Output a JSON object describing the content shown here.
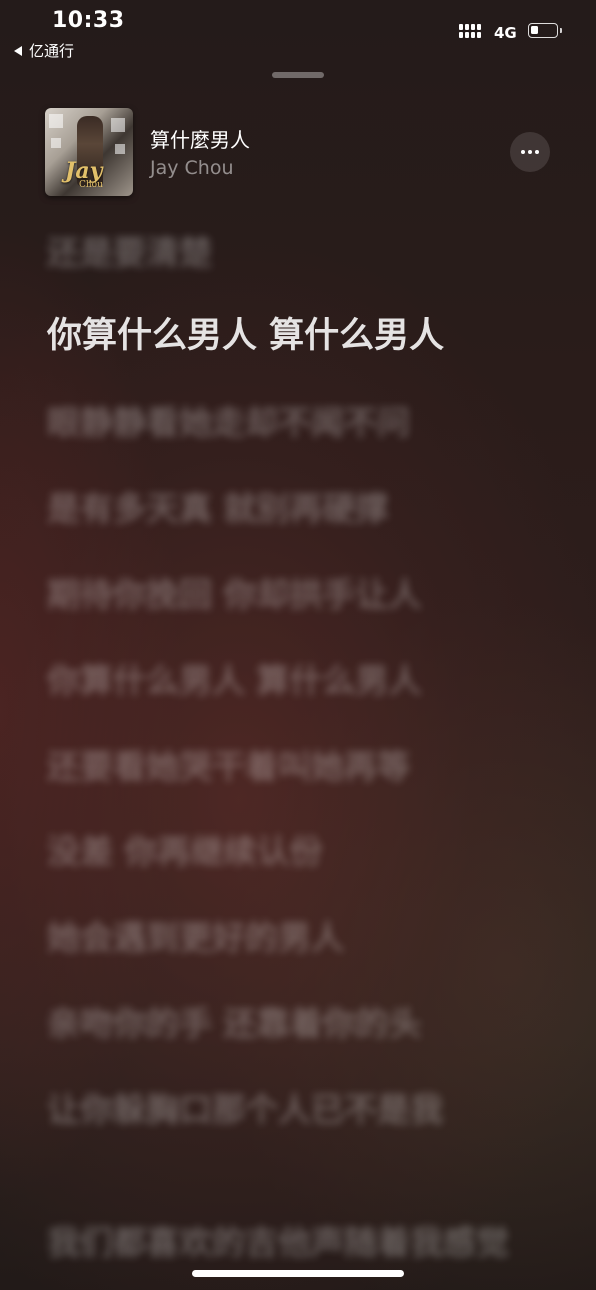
{
  "status_bar": {
    "time": "10:33",
    "back_app": "亿通行",
    "network": "4G",
    "battery_level": 0.2
  },
  "now_playing": {
    "title": "算什麼男人",
    "artist": "Jay Chou",
    "cover_text": "Jay",
    "cover_subtext": "Chou",
    "more_icon": "ellipsis-icon"
  },
  "lyrics": [
    "还是要清楚",
    "你算什么男人 算什么男人",
    "眼静静看她走却不闻不问",
    "是有多天真 就别再硬撑",
    "期待你挽回 你却拱手让人",
    "你算什么男人 算什么男人",
    "还要看她哭干着叫她再等",
    "没差 你再继续认份",
    "她会遇到更好的男人",
    "亲吻你的手 还靠着你的头",
    "让你躲胸口那个人已不是我",
    "我们都喜欢的吉他声随着我感觉"
  ],
  "active_lyric_index": 1
}
